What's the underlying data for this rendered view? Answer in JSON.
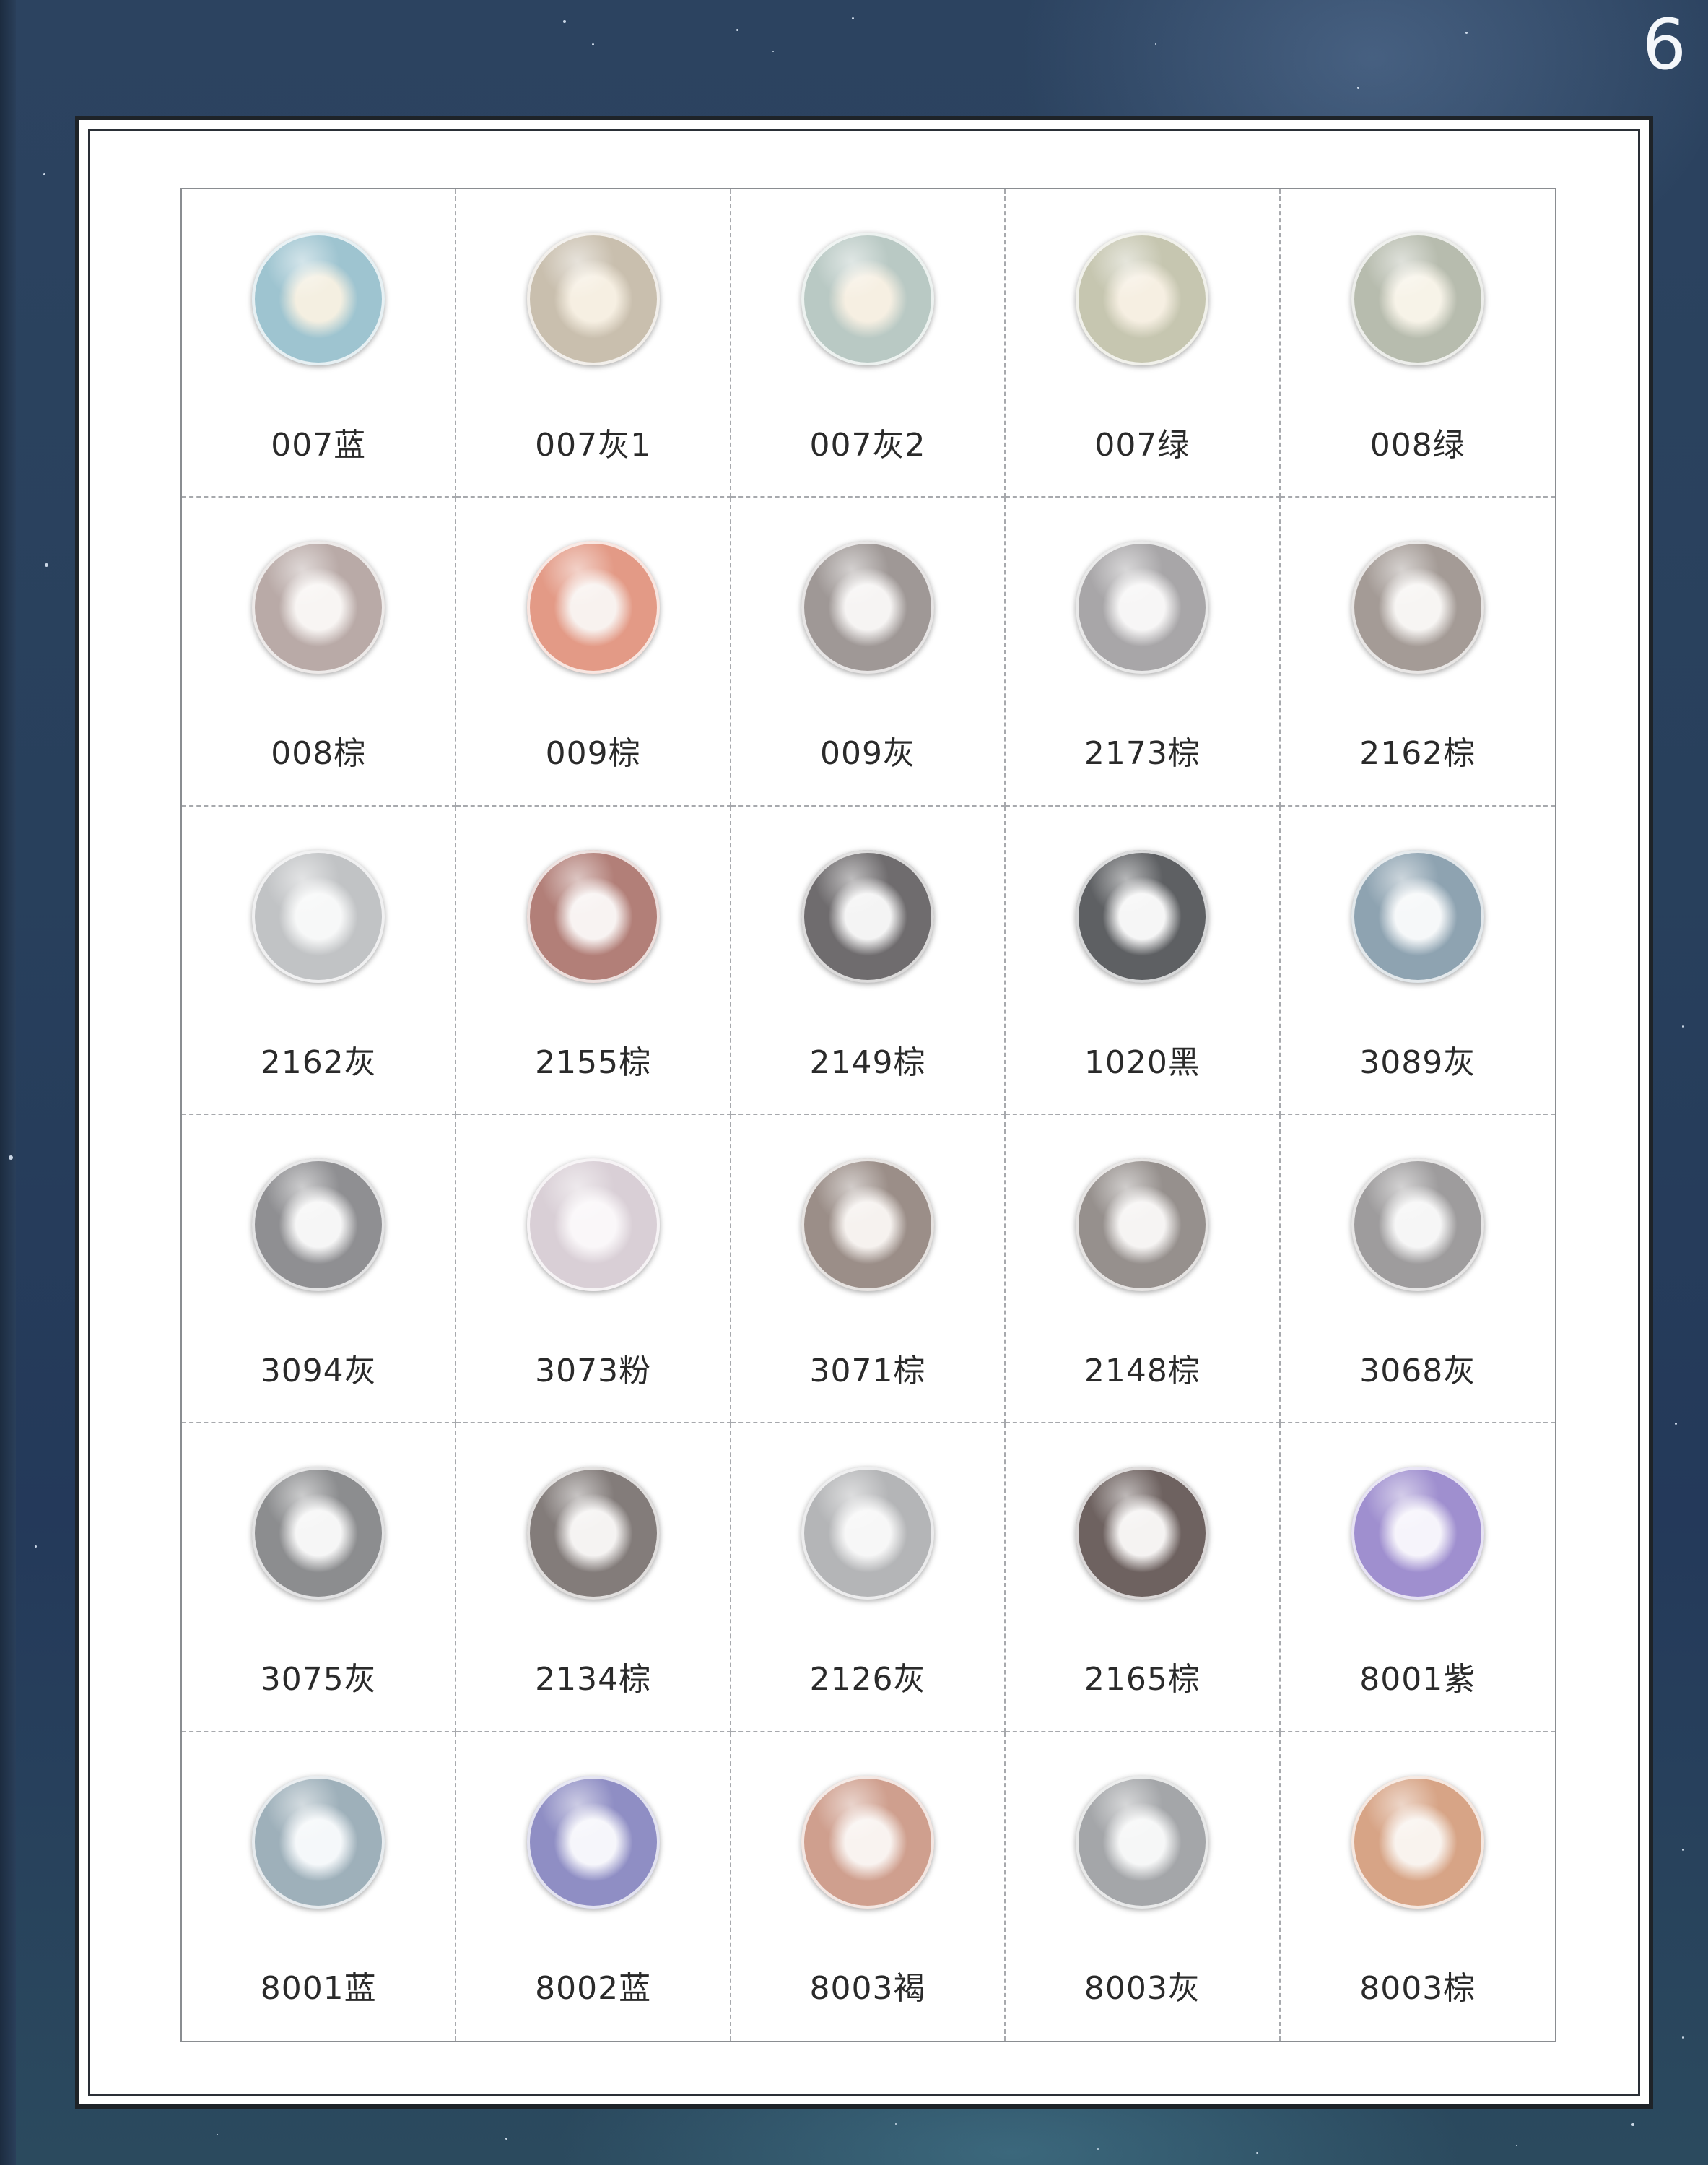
{
  "page": {
    "number": "6"
  },
  "catalog": {
    "items": [
      {
        "label": "007蓝",
        "tone": "blue-grey",
        "color": "#9ec4d0",
        "pupil": "#f4efe1"
      },
      {
        "label": "007灰1",
        "tone": "grey-beige",
        "color": "#c9bfae",
        "pupil": "#f6efe2"
      },
      {
        "label": "007灰2",
        "tone": "grey-green",
        "color": "#b9c9c4",
        "pupil": "#f6efe2"
      },
      {
        "label": "007绿",
        "tone": "green-beige",
        "color": "#c6c6b0",
        "pupil": "#f6efe2"
      },
      {
        "label": "008绿",
        "tone": "green-grey",
        "color": "#b7bcae",
        "pupil": "#f7f3e8"
      },
      {
        "label": "008棕",
        "tone": "light-brown",
        "color": "#b9aaa7",
        "pupil": "#f8f5f3"
      },
      {
        "label": "009棕",
        "tone": "coral-brown",
        "color": "#e39a86",
        "pupil": "#f8f2ef"
      },
      {
        "label": "009灰",
        "tone": "grey",
        "color": "#9f9896",
        "pupil": "#f6f4f3"
      },
      {
        "label": "2173棕",
        "tone": "grey-brown",
        "color": "#a8a6a8",
        "pupil": "#f7f6f6"
      },
      {
        "label": "2162棕",
        "tone": "taupe",
        "color": "#a49b96",
        "pupil": "#f7f5f3"
      },
      {
        "label": "2162灰",
        "tone": "light-grey",
        "color": "#c1c3c5",
        "pupil": "#f7f8f8"
      },
      {
        "label": "2155棕",
        "tone": "dark-rose",
        "color": "#b27f78",
        "pupil": "#f8f3f2"
      },
      {
        "label": "2149棕",
        "tone": "dark-grey",
        "color": "#6f6c6e",
        "pupil": "#f4f4f4"
      },
      {
        "label": "1020黑",
        "tone": "black",
        "color": "#5e6063",
        "pupil": "#f6f6f6"
      },
      {
        "label": "3089灰",
        "tone": "blue-grey",
        "color": "#8ea3b1",
        "pupil": "#f6f8f9"
      },
      {
        "label": "3094灰",
        "tone": "grey",
        "color": "#8f8f92",
        "pupil": "#f6f6f6"
      },
      {
        "label": "3073粉",
        "tone": "pink",
        "color": "#d9cfd6",
        "pupil": "#faf7f9"
      },
      {
        "label": "3071棕",
        "tone": "brown-grey",
        "color": "#9b8e88",
        "pupil": "#f6f2ef"
      },
      {
        "label": "2148棕",
        "tone": "brown-grey",
        "color": "#96908d",
        "pupil": "#f6f4f3"
      },
      {
        "label": "3068灰",
        "tone": "grey",
        "color": "#9e9c9d",
        "pupil": "#f6f6f6"
      },
      {
        "label": "3075灰",
        "tone": "grey",
        "color": "#8c8d8f",
        "pupil": "#f6f6f6"
      },
      {
        "label": "2134棕",
        "tone": "dark-brown-grey",
        "color": "#837c7a",
        "pupil": "#f5f3f2"
      },
      {
        "label": "2126灰",
        "tone": "light-grey",
        "color": "#b4b5b7",
        "pupil": "#f7f7f7"
      },
      {
        "label": "2165棕",
        "tone": "dark-brown",
        "color": "#6e6260",
        "pupil": "#f5f3f2"
      },
      {
        "label": "8001紫",
        "tone": "purple",
        "color": "#9f8fcf",
        "pupil": "#f6f4fb"
      },
      {
        "label": "8001蓝",
        "tone": "blue-grey",
        "color": "#9eb0ba",
        "pupil": "#f5f8fa"
      },
      {
        "label": "8002蓝",
        "tone": "violet-blue",
        "color": "#8f8ec4",
        "pupil": "#f6f6fb"
      },
      {
        "label": "8003褐",
        "tone": "salmon-brown",
        "color": "#cf9f8e",
        "pupil": "#f9f3f0"
      },
      {
        "label": "8003灰",
        "tone": "grey",
        "color": "#a4a6a9",
        "pupil": "#f6f7f7"
      },
      {
        "label": "8003棕",
        "tone": "orange-brown",
        "color": "#d7a486",
        "pupil": "#f9f3ee"
      }
    ]
  }
}
